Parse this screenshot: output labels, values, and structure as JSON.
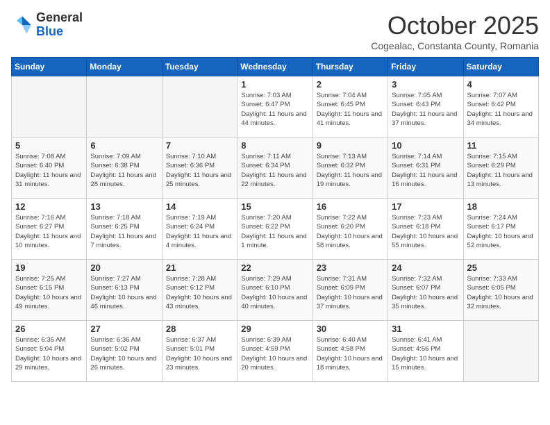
{
  "header": {
    "logo_general": "General",
    "logo_blue": "Blue",
    "month_year": "October 2025",
    "location": "Cogealac, Constanta County, Romania"
  },
  "days_of_week": [
    "Sunday",
    "Monday",
    "Tuesday",
    "Wednesday",
    "Thursday",
    "Friday",
    "Saturday"
  ],
  "weeks": [
    [
      {
        "day": "",
        "empty": true
      },
      {
        "day": "",
        "empty": true
      },
      {
        "day": "",
        "empty": true
      },
      {
        "day": "1",
        "sunrise": "Sunrise: 7:03 AM",
        "sunset": "Sunset: 6:47 PM",
        "daylight": "Daylight: 11 hours and 44 minutes."
      },
      {
        "day": "2",
        "sunrise": "Sunrise: 7:04 AM",
        "sunset": "Sunset: 6:45 PM",
        "daylight": "Daylight: 11 hours and 41 minutes."
      },
      {
        "day": "3",
        "sunrise": "Sunrise: 7:05 AM",
        "sunset": "Sunset: 6:43 PM",
        "daylight": "Daylight: 11 hours and 37 minutes."
      },
      {
        "day": "4",
        "sunrise": "Sunrise: 7:07 AM",
        "sunset": "Sunset: 6:42 PM",
        "daylight": "Daylight: 11 hours and 34 minutes."
      }
    ],
    [
      {
        "day": "5",
        "sunrise": "Sunrise: 7:08 AM",
        "sunset": "Sunset: 6:40 PM",
        "daylight": "Daylight: 11 hours and 31 minutes."
      },
      {
        "day": "6",
        "sunrise": "Sunrise: 7:09 AM",
        "sunset": "Sunset: 6:38 PM",
        "daylight": "Daylight: 11 hours and 28 minutes."
      },
      {
        "day": "7",
        "sunrise": "Sunrise: 7:10 AM",
        "sunset": "Sunset: 6:36 PM",
        "daylight": "Daylight: 11 hours and 25 minutes."
      },
      {
        "day": "8",
        "sunrise": "Sunrise: 7:11 AM",
        "sunset": "Sunset: 6:34 PM",
        "daylight": "Daylight: 11 hours and 22 minutes."
      },
      {
        "day": "9",
        "sunrise": "Sunrise: 7:13 AM",
        "sunset": "Sunset: 6:32 PM",
        "daylight": "Daylight: 11 hours and 19 minutes."
      },
      {
        "day": "10",
        "sunrise": "Sunrise: 7:14 AM",
        "sunset": "Sunset: 6:31 PM",
        "daylight": "Daylight: 11 hours and 16 minutes."
      },
      {
        "day": "11",
        "sunrise": "Sunrise: 7:15 AM",
        "sunset": "Sunset: 6:29 PM",
        "daylight": "Daylight: 11 hours and 13 minutes."
      }
    ],
    [
      {
        "day": "12",
        "sunrise": "Sunrise: 7:16 AM",
        "sunset": "Sunset: 6:27 PM",
        "daylight": "Daylight: 11 hours and 10 minutes."
      },
      {
        "day": "13",
        "sunrise": "Sunrise: 7:18 AM",
        "sunset": "Sunset: 6:25 PM",
        "daylight": "Daylight: 11 hours and 7 minutes."
      },
      {
        "day": "14",
        "sunrise": "Sunrise: 7:19 AM",
        "sunset": "Sunset: 6:24 PM",
        "daylight": "Daylight: 11 hours and 4 minutes."
      },
      {
        "day": "15",
        "sunrise": "Sunrise: 7:20 AM",
        "sunset": "Sunset: 6:22 PM",
        "daylight": "Daylight: 11 hours and 1 minute."
      },
      {
        "day": "16",
        "sunrise": "Sunrise: 7:22 AM",
        "sunset": "Sunset: 6:20 PM",
        "daylight": "Daylight: 10 hours and 58 minutes."
      },
      {
        "day": "17",
        "sunrise": "Sunrise: 7:23 AM",
        "sunset": "Sunset: 6:18 PM",
        "daylight": "Daylight: 10 hours and 55 minutes."
      },
      {
        "day": "18",
        "sunrise": "Sunrise: 7:24 AM",
        "sunset": "Sunset: 6:17 PM",
        "daylight": "Daylight: 10 hours and 52 minutes."
      }
    ],
    [
      {
        "day": "19",
        "sunrise": "Sunrise: 7:25 AM",
        "sunset": "Sunset: 6:15 PM",
        "daylight": "Daylight: 10 hours and 49 minutes."
      },
      {
        "day": "20",
        "sunrise": "Sunrise: 7:27 AM",
        "sunset": "Sunset: 6:13 PM",
        "daylight": "Daylight: 10 hours and 46 minutes."
      },
      {
        "day": "21",
        "sunrise": "Sunrise: 7:28 AM",
        "sunset": "Sunset: 6:12 PM",
        "daylight": "Daylight: 10 hours and 43 minutes."
      },
      {
        "day": "22",
        "sunrise": "Sunrise: 7:29 AM",
        "sunset": "Sunset: 6:10 PM",
        "daylight": "Daylight: 10 hours and 40 minutes."
      },
      {
        "day": "23",
        "sunrise": "Sunrise: 7:31 AM",
        "sunset": "Sunset: 6:09 PM",
        "daylight": "Daylight: 10 hours and 37 minutes."
      },
      {
        "day": "24",
        "sunrise": "Sunrise: 7:32 AM",
        "sunset": "Sunset: 6:07 PM",
        "daylight": "Daylight: 10 hours and 35 minutes."
      },
      {
        "day": "25",
        "sunrise": "Sunrise: 7:33 AM",
        "sunset": "Sunset: 6:05 PM",
        "daylight": "Daylight: 10 hours and 32 minutes."
      }
    ],
    [
      {
        "day": "26",
        "sunrise": "Sunrise: 6:35 AM",
        "sunset": "Sunset: 5:04 PM",
        "daylight": "Daylight: 10 hours and 29 minutes."
      },
      {
        "day": "27",
        "sunrise": "Sunrise: 6:36 AM",
        "sunset": "Sunset: 5:02 PM",
        "daylight": "Daylight: 10 hours and 26 minutes."
      },
      {
        "day": "28",
        "sunrise": "Sunrise: 6:37 AM",
        "sunset": "Sunset: 5:01 PM",
        "daylight": "Daylight: 10 hours and 23 minutes."
      },
      {
        "day": "29",
        "sunrise": "Sunrise: 6:39 AM",
        "sunset": "Sunset: 4:59 PM",
        "daylight": "Daylight: 10 hours and 20 minutes."
      },
      {
        "day": "30",
        "sunrise": "Sunrise: 6:40 AM",
        "sunset": "Sunset: 4:58 PM",
        "daylight": "Daylight: 10 hours and 18 minutes."
      },
      {
        "day": "31",
        "sunrise": "Sunrise: 6:41 AM",
        "sunset": "Sunset: 4:56 PM",
        "daylight": "Daylight: 10 hours and 15 minutes."
      },
      {
        "day": "",
        "empty": true
      }
    ]
  ]
}
